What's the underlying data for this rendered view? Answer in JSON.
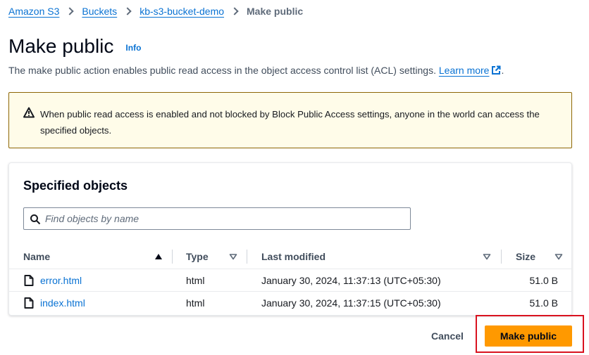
{
  "breadcrumb": {
    "items": [
      "Amazon S3",
      "Buckets",
      "kb-s3-bucket-demo"
    ],
    "current": "Make public"
  },
  "header": {
    "title": "Make public",
    "info": "Info",
    "description": "The make public action enables public read access in the object access control list (ACL) settings.",
    "learn_more": "Learn more",
    "description_end": "."
  },
  "alert": {
    "icon": "warning-icon",
    "text": "When public read access is enabled and not blocked by Block Public Access settings, anyone in the world can access the specified objects."
  },
  "objects": {
    "title": "Specified objects",
    "search_placeholder": "Find objects by name",
    "search_value": "",
    "columns": [
      "Name",
      "Type",
      "Last modified",
      "Size"
    ],
    "rows": [
      {
        "name": "error.html",
        "type": "html",
        "modified": "January 30, 2024, 11:37:13 (UTC+05:30)",
        "size": "51.0 B"
      },
      {
        "name": "index.html",
        "type": "html",
        "modified": "January 30, 2024, 11:37:15 (UTC+05:30)",
        "size": "51.0 B"
      }
    ]
  },
  "footer": {
    "cancel": "Cancel",
    "submit": "Make public"
  },
  "colors": {
    "link": "#0972d3",
    "primary": "#ff9900",
    "warning_bg": "#fffce9",
    "warning_border": "#8d6605",
    "highlight": "#d9121f"
  }
}
